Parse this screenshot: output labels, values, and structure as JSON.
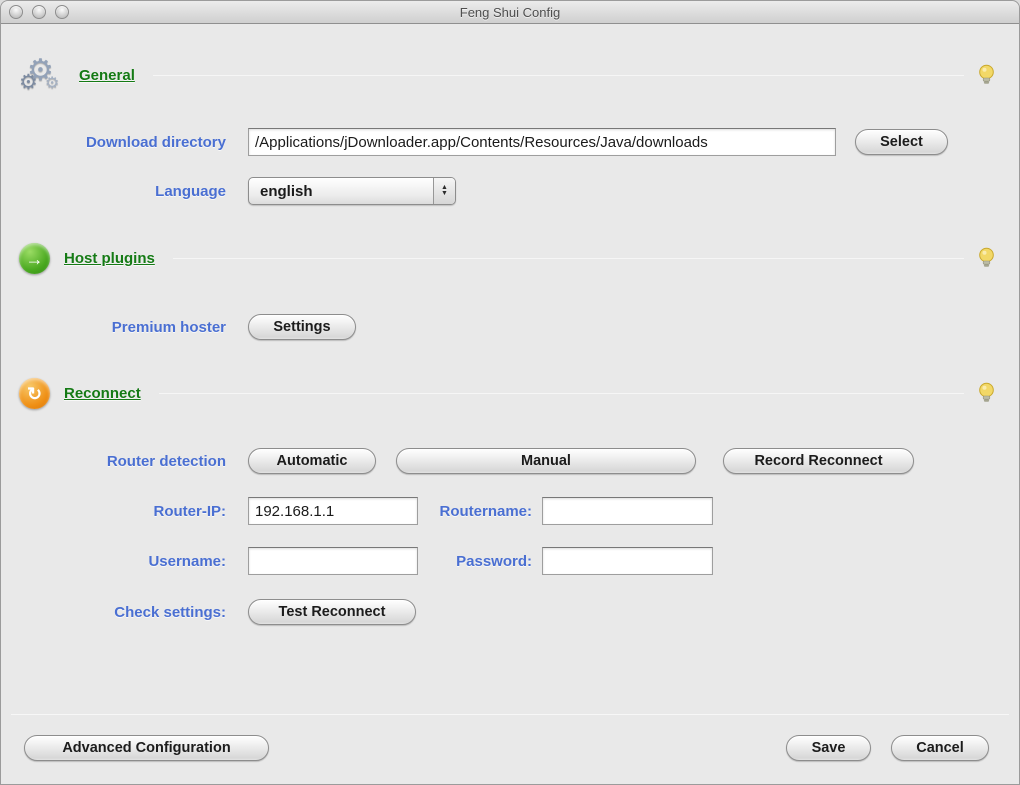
{
  "window": {
    "title": "Feng Shui Config"
  },
  "sections": {
    "general": {
      "title": "General",
      "rows": {
        "download_directory": {
          "label": "Download directory",
          "value": "/Applications/jDownloader.app/Contents/Resources/Java/downloads",
          "select_button": "Select"
        },
        "language": {
          "label": "Language",
          "value": "english"
        }
      }
    },
    "host_plugins": {
      "title": "Host plugins",
      "rows": {
        "premium_hoster": {
          "label": "Premium hoster",
          "settings_button": "Settings"
        }
      }
    },
    "reconnect": {
      "title": "Reconnect",
      "rows": {
        "router_detection": {
          "label": "Router detection",
          "automatic_button": "Automatic",
          "manual_button": "Manual",
          "record_button": "Record Reconnect"
        },
        "router_ip": {
          "label": "Router-IP:",
          "value": "192.168.1.1"
        },
        "routername": {
          "label": "Routername:",
          "value": ""
        },
        "username": {
          "label": "Username:",
          "value": ""
        },
        "password": {
          "label": "Password:",
          "value": ""
        },
        "check_settings": {
          "label": "Check settings:",
          "test_button": "Test Reconnect"
        }
      }
    }
  },
  "footer": {
    "advanced_button": "Advanced Configuration",
    "save_button": "Save",
    "cancel_button": "Cancel"
  },
  "icons": {
    "gear_glyph": "⚙",
    "host_plugins_glyph": "→",
    "reconnect_glyph": "↻",
    "popup_up": "▲",
    "popup_down": "▼"
  },
  "colors": {
    "label_blue": "#4a6fd2",
    "section_green": "#157a15",
    "bulb_yellow": "#f2d867"
  }
}
